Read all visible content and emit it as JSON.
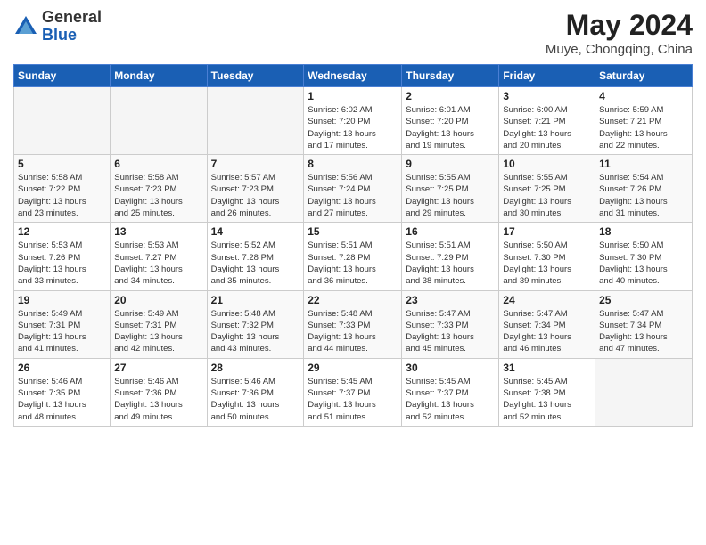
{
  "header": {
    "logo_general": "General",
    "logo_blue": "Blue",
    "month_year": "May 2024",
    "location": "Muye, Chongqing, China"
  },
  "weekdays": [
    "Sunday",
    "Monday",
    "Tuesday",
    "Wednesday",
    "Thursday",
    "Friday",
    "Saturday"
  ],
  "weeks": [
    [
      {
        "day": "",
        "info": ""
      },
      {
        "day": "",
        "info": ""
      },
      {
        "day": "",
        "info": ""
      },
      {
        "day": "1",
        "info": "Sunrise: 6:02 AM\nSunset: 7:20 PM\nDaylight: 13 hours\nand 17 minutes."
      },
      {
        "day": "2",
        "info": "Sunrise: 6:01 AM\nSunset: 7:20 PM\nDaylight: 13 hours\nand 19 minutes."
      },
      {
        "day": "3",
        "info": "Sunrise: 6:00 AM\nSunset: 7:21 PM\nDaylight: 13 hours\nand 20 minutes."
      },
      {
        "day": "4",
        "info": "Sunrise: 5:59 AM\nSunset: 7:21 PM\nDaylight: 13 hours\nand 22 minutes."
      }
    ],
    [
      {
        "day": "5",
        "info": "Sunrise: 5:58 AM\nSunset: 7:22 PM\nDaylight: 13 hours\nand 23 minutes."
      },
      {
        "day": "6",
        "info": "Sunrise: 5:58 AM\nSunset: 7:23 PM\nDaylight: 13 hours\nand 25 minutes."
      },
      {
        "day": "7",
        "info": "Sunrise: 5:57 AM\nSunset: 7:23 PM\nDaylight: 13 hours\nand 26 minutes."
      },
      {
        "day": "8",
        "info": "Sunrise: 5:56 AM\nSunset: 7:24 PM\nDaylight: 13 hours\nand 27 minutes."
      },
      {
        "day": "9",
        "info": "Sunrise: 5:55 AM\nSunset: 7:25 PM\nDaylight: 13 hours\nand 29 minutes."
      },
      {
        "day": "10",
        "info": "Sunrise: 5:55 AM\nSunset: 7:25 PM\nDaylight: 13 hours\nand 30 minutes."
      },
      {
        "day": "11",
        "info": "Sunrise: 5:54 AM\nSunset: 7:26 PM\nDaylight: 13 hours\nand 31 minutes."
      }
    ],
    [
      {
        "day": "12",
        "info": "Sunrise: 5:53 AM\nSunset: 7:26 PM\nDaylight: 13 hours\nand 33 minutes."
      },
      {
        "day": "13",
        "info": "Sunrise: 5:53 AM\nSunset: 7:27 PM\nDaylight: 13 hours\nand 34 minutes."
      },
      {
        "day": "14",
        "info": "Sunrise: 5:52 AM\nSunset: 7:28 PM\nDaylight: 13 hours\nand 35 minutes."
      },
      {
        "day": "15",
        "info": "Sunrise: 5:51 AM\nSunset: 7:28 PM\nDaylight: 13 hours\nand 36 minutes."
      },
      {
        "day": "16",
        "info": "Sunrise: 5:51 AM\nSunset: 7:29 PM\nDaylight: 13 hours\nand 38 minutes."
      },
      {
        "day": "17",
        "info": "Sunrise: 5:50 AM\nSunset: 7:30 PM\nDaylight: 13 hours\nand 39 minutes."
      },
      {
        "day": "18",
        "info": "Sunrise: 5:50 AM\nSunset: 7:30 PM\nDaylight: 13 hours\nand 40 minutes."
      }
    ],
    [
      {
        "day": "19",
        "info": "Sunrise: 5:49 AM\nSunset: 7:31 PM\nDaylight: 13 hours\nand 41 minutes."
      },
      {
        "day": "20",
        "info": "Sunrise: 5:49 AM\nSunset: 7:31 PM\nDaylight: 13 hours\nand 42 minutes."
      },
      {
        "day": "21",
        "info": "Sunrise: 5:48 AM\nSunset: 7:32 PM\nDaylight: 13 hours\nand 43 minutes."
      },
      {
        "day": "22",
        "info": "Sunrise: 5:48 AM\nSunset: 7:33 PM\nDaylight: 13 hours\nand 44 minutes."
      },
      {
        "day": "23",
        "info": "Sunrise: 5:47 AM\nSunset: 7:33 PM\nDaylight: 13 hours\nand 45 minutes."
      },
      {
        "day": "24",
        "info": "Sunrise: 5:47 AM\nSunset: 7:34 PM\nDaylight: 13 hours\nand 46 minutes."
      },
      {
        "day": "25",
        "info": "Sunrise: 5:47 AM\nSunset: 7:34 PM\nDaylight: 13 hours\nand 47 minutes."
      }
    ],
    [
      {
        "day": "26",
        "info": "Sunrise: 5:46 AM\nSunset: 7:35 PM\nDaylight: 13 hours\nand 48 minutes."
      },
      {
        "day": "27",
        "info": "Sunrise: 5:46 AM\nSunset: 7:36 PM\nDaylight: 13 hours\nand 49 minutes."
      },
      {
        "day": "28",
        "info": "Sunrise: 5:46 AM\nSunset: 7:36 PM\nDaylight: 13 hours\nand 50 minutes."
      },
      {
        "day": "29",
        "info": "Sunrise: 5:45 AM\nSunset: 7:37 PM\nDaylight: 13 hours\nand 51 minutes."
      },
      {
        "day": "30",
        "info": "Sunrise: 5:45 AM\nSunset: 7:37 PM\nDaylight: 13 hours\nand 52 minutes."
      },
      {
        "day": "31",
        "info": "Sunrise: 5:45 AM\nSunset: 7:38 PM\nDaylight: 13 hours\nand 52 minutes."
      },
      {
        "day": "",
        "info": ""
      }
    ]
  ]
}
